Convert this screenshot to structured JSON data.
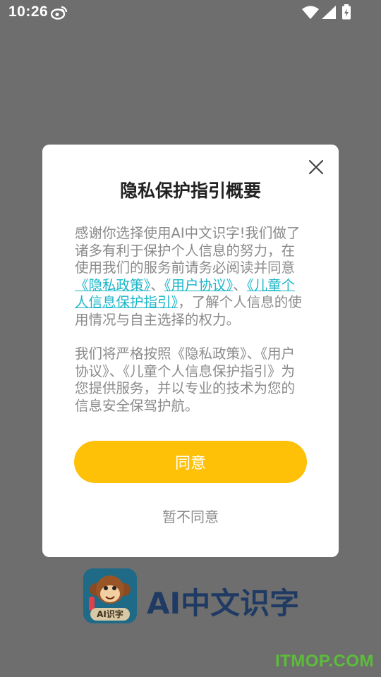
{
  "status_bar": {
    "time": "10:26",
    "icons": [
      "weibo-icon",
      "wifi-icon",
      "signal-icon",
      "battery-icon"
    ]
  },
  "dialog": {
    "title": "隐私保护指引概要",
    "close_icon": "close-icon",
    "para1_part1": "感谢你选择使用AI中文识字!我们做了诸多有利于保护个人信息的努力，在使用我们的服务前请务必阅读并同意",
    "link_privacy": "《隐私政策》",
    "sep1": "、",
    "link_user": "《用户协议》",
    "sep2": "、",
    "link_child": "《儿童个人信息保护指引》",
    "para1_part2": "，了解个人信息的使用情况与自主选择的权力。",
    "para2": "我们将严格按照《隐私政策》、《用户协议》、《儿童个人信息保护指引》为您提供服务，并以专业的技术为您的信息安全保驾护航。",
    "agree_label": "同意",
    "disagree_label": "暂不同意"
  },
  "brand": {
    "app_name": "AI中文识字",
    "logo_badge": "AI识字"
  },
  "watermark": "ITMOP.COM",
  "colors": {
    "overlay": "#6e6e6e",
    "agree_button": "#fec108",
    "link": "#19b6c8",
    "body_text": "#8a8a8a",
    "title_text": "#222222",
    "app_name": "#1f3a63",
    "watermark": "#5cbd3a"
  }
}
